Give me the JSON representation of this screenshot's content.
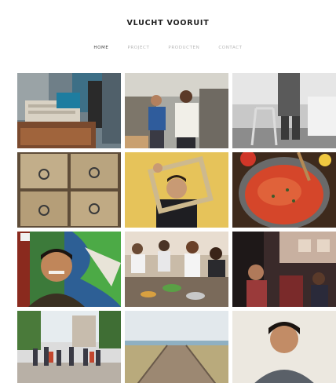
{
  "site": {
    "title": "VLUCHT VOORUIT"
  },
  "nav": {
    "items": [
      {
        "label": "HOME",
        "active": true
      },
      {
        "label": "PROJECT",
        "active": false
      },
      {
        "label": "PRODUCTEN",
        "active": false
      },
      {
        "label": "CONTACT",
        "active": false
      }
    ]
  },
  "gallery": {
    "images": [
      {
        "subject": "crates-market-stall"
      },
      {
        "subject": "workers-in-warehouse"
      },
      {
        "subject": "elderly-walker-bw"
      },
      {
        "subject": "wooden-drawers"
      },
      {
        "subject": "man-with-picture-frame"
      },
      {
        "subject": "tomato-soup-pot"
      },
      {
        "subject": "smiling-man-graffiti-wall"
      },
      {
        "subject": "cooking-workshop"
      },
      {
        "subject": "crowded-event-hall"
      },
      {
        "subject": "street-crowd"
      },
      {
        "subject": "wooden-boardwalk-beach"
      },
      {
        "subject": "portrait-young-man"
      }
    ]
  },
  "colors": {
    "title": "#1e1e1e",
    "nav_active": "#444444",
    "nav_inactive": "#b8b8b8",
    "background": "#ffffff"
  }
}
